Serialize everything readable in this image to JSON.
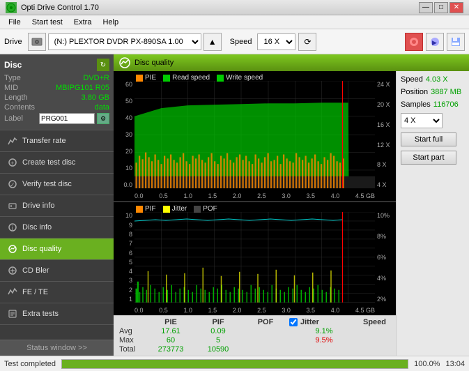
{
  "window": {
    "title": "Opti Drive Control 1.70",
    "icon": "disc-icon"
  },
  "title_buttons": {
    "minimize": "—",
    "maximize": "□",
    "close": "✕"
  },
  "menu": {
    "items": [
      "File",
      "Start test",
      "Extra",
      "Help"
    ]
  },
  "toolbar": {
    "drive_label": "Drive",
    "drive_value": "(N:)  PLEXTOR DVDR  PX-890SA 1.00",
    "speed_label": "Speed",
    "speed_value": "16 X"
  },
  "disc_info": {
    "title": "Disc",
    "refresh_icon": "↻",
    "type_label": "Type",
    "type_value": "DVD+R",
    "mid_label": "MID",
    "mid_value": "MBIPG101 R05",
    "length_label": "Length",
    "length_value": "3.80 GB",
    "contents_label": "Contents",
    "contents_value": "data",
    "label_label": "Label",
    "label_value": "PRG001",
    "label_icon": "gear-icon"
  },
  "nav": {
    "items": [
      {
        "id": "transfer-rate",
        "label": "Transfer rate",
        "active": false
      },
      {
        "id": "create-test-disc",
        "label": "Create test disc",
        "active": false
      },
      {
        "id": "verify-test-disc",
        "label": "Verify test disc",
        "active": false
      },
      {
        "id": "drive-info",
        "label": "Drive info",
        "active": false
      },
      {
        "id": "disc-info",
        "label": "Disc info",
        "active": false
      },
      {
        "id": "disc-quality",
        "label": "Disc quality",
        "active": true
      },
      {
        "id": "cd-bler",
        "label": "CD Bler",
        "active": false
      },
      {
        "id": "fe-te",
        "label": "FE / TE",
        "active": false
      },
      {
        "id": "extra-tests",
        "label": "Extra tests",
        "active": false
      }
    ],
    "status_window": "Status window >>"
  },
  "disc_quality_panel": {
    "title": "Disc quality",
    "chart_top": {
      "legend": [
        {
          "color": "#ff8800",
          "label": "PIE"
        },
        {
          "color": "#00cc00",
          "label": "Read speed"
        },
        {
          "color": "#00cc00",
          "label": "Write speed"
        }
      ],
      "y_labels": [
        "60",
        "50",
        "40",
        "30",
        "20",
        "10",
        "0.0"
      ],
      "y_labels_right": [
        "24 X",
        "20 X",
        "16 X",
        "12 X",
        "8 X",
        "4 X"
      ],
      "x_labels": [
        "0.0",
        "0.5",
        "1.0",
        "1.5",
        "2.0",
        "2.5",
        "3.0",
        "3.5",
        "4.0",
        "4.5 GB"
      ]
    },
    "chart_bottom": {
      "legend": [
        {
          "color": "#ff8800",
          "label": "PIF"
        },
        {
          "color": "#ffff00",
          "label": "Jitter"
        },
        {
          "color": "#444",
          "label": "POF"
        }
      ],
      "y_labels": [
        "10",
        "9",
        "8",
        "7",
        "6",
        "5",
        "4",
        "3",
        "2",
        "1"
      ],
      "y_labels_right": [
        "10%",
        "8%",
        "6%",
        "4%",
        "2%"
      ],
      "x_labels": [
        "0.0",
        "0.5",
        "1.0",
        "1.5",
        "2.0",
        "2.5",
        "3.0",
        "3.5",
        "4.0",
        "4.5 GB"
      ]
    },
    "stats": {
      "headers": [
        "PIE",
        "PIF",
        "POF",
        "Jitter",
        "Speed",
        ""
      ],
      "jitter_checked": true,
      "avg_label": "Avg",
      "max_label": "Max",
      "total_label": "Total",
      "pie_avg": "17.61",
      "pie_max": "60",
      "pie_total": "273773",
      "pif_avg": "0.09",
      "pif_max": "5",
      "pif_total": "10590",
      "pof_avg": "",
      "pof_max": "",
      "pof_total": "",
      "jitter_avg": "9.1%",
      "jitter_max": "9.5%",
      "jitter_total": "",
      "speed_label": "Speed",
      "speed_value": "4.03 X",
      "position_label": "Position",
      "position_value": "3887 MB",
      "samples_label": "Samples",
      "samples_value": "116706",
      "speed_select": "4 X",
      "start_full_btn": "Start full",
      "start_part_btn": "Start part"
    }
  },
  "bottom_bar": {
    "status": "Test completed",
    "progress": "100.0%",
    "time": "13:04"
  }
}
